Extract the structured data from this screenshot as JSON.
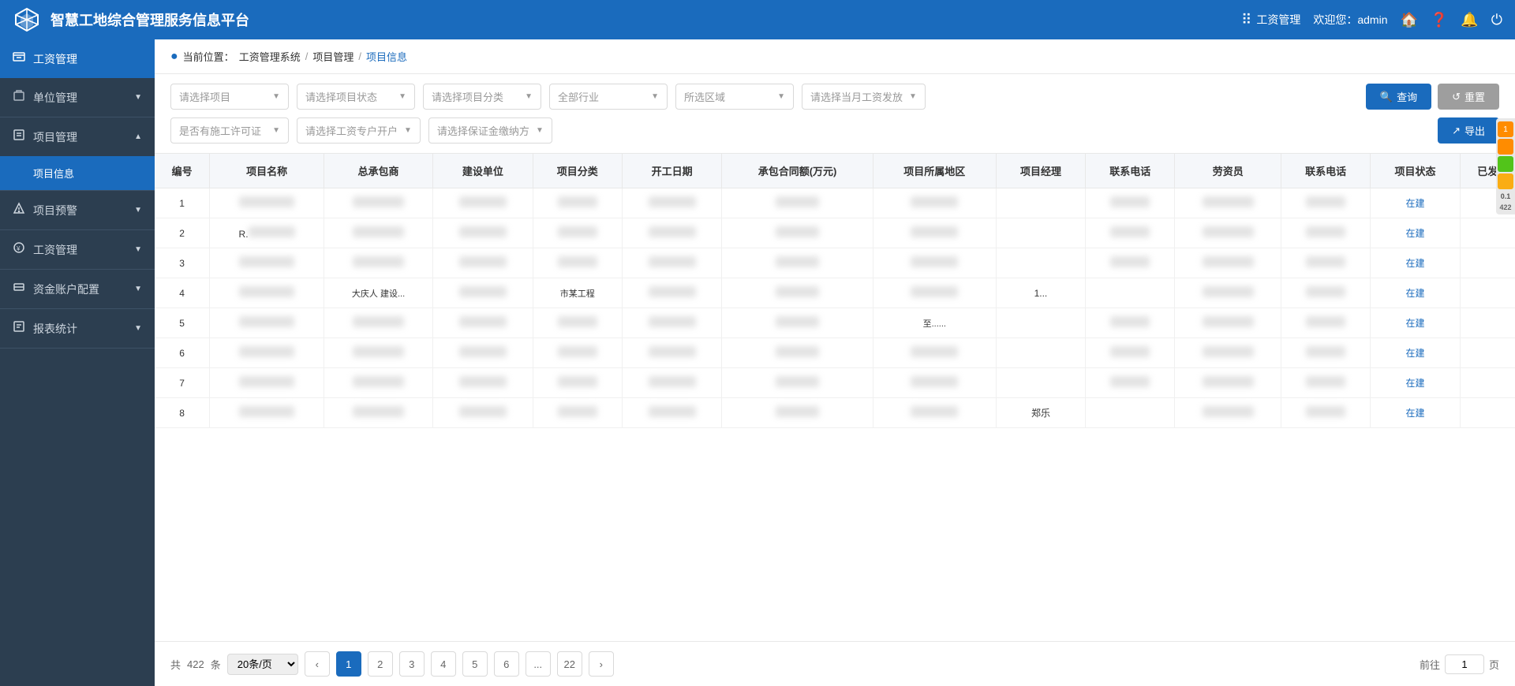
{
  "header": {
    "title": "智慧工地综合管理服务信息平台",
    "module_label": "工资管理",
    "welcome": "欢迎您：admin"
  },
  "breadcrumb": {
    "prefix": "当前位置：",
    "path": [
      "工资管理系统",
      "项目管理",
      "项目信息"
    ]
  },
  "filters": {
    "row1": [
      {
        "id": "select-project",
        "placeholder": "请选择项目"
      },
      {
        "id": "select-status",
        "placeholder": "请选择项目状态"
      },
      {
        "id": "select-category",
        "placeholder": "请选择项目分类"
      },
      {
        "id": "select-industry",
        "placeholder": "全部行业"
      },
      {
        "id": "select-region",
        "placeholder": "所选区域"
      },
      {
        "id": "select-salary",
        "placeholder": "请选择当月工资发放"
      }
    ],
    "row2": [
      {
        "id": "select-permit",
        "placeholder": "是否有施工许可证"
      },
      {
        "id": "select-account",
        "placeholder": "请选择工资专户开户"
      },
      {
        "id": "select-deposit",
        "placeholder": "请选择保证金缴纳方"
      }
    ],
    "buttons": {
      "query": "查询",
      "reset": "重置",
      "export": "导出"
    }
  },
  "table": {
    "columns": [
      "编号",
      "项目名称",
      "总承包商",
      "建设单位",
      "项目分类",
      "开工日期",
      "承包合同额(万元)",
      "项目所属地区",
      "项目经理",
      "联系电话",
      "劳资员",
      "联系电话",
      "项目状态",
      "已发"
    ],
    "rows": [
      {
        "id": 1,
        "status": "在建"
      },
      {
        "id": 2,
        "col2": "R...",
        "status": "在建"
      },
      {
        "id": 3,
        "status": "在建"
      },
      {
        "id": 4,
        "col3_partial": "大庆人  建设...",
        "col5": "市某工程",
        "status": "在建",
        "pm": "1..."
      },
      {
        "id": 5,
        "col8_partial": "至......",
        "status": "在建"
      },
      {
        "id": 6,
        "status": "在建"
      },
      {
        "id": 7,
        "status": "在建"
      },
      {
        "id": 8,
        "pm": "郑乐",
        "status": "在建"
      }
    ]
  },
  "pagination": {
    "total_prefix": "共",
    "total": "422",
    "total_suffix": "条",
    "page_size": "20条/页",
    "pages": [
      "1",
      "2",
      "3",
      "4",
      "5",
      "6",
      "...",
      "22"
    ],
    "jump_prefix": "前往",
    "jump_value": "1",
    "jump_suffix": "页"
  },
  "sidebar": {
    "top_item": {
      "label": "工资管理",
      "icon": "📋"
    },
    "items": [
      {
        "label": "单位管理",
        "icon": "🏢",
        "has_arrow": true,
        "expanded": false
      },
      {
        "label": "项目管理",
        "icon": "📁",
        "has_arrow": true,
        "expanded": true
      },
      {
        "label": "项目信息",
        "sub": true,
        "active": true
      },
      {
        "label": "项目预警",
        "icon": "⚠️",
        "has_arrow": true,
        "expanded": false
      },
      {
        "label": "工资管理",
        "icon": "💰",
        "has_arrow": true,
        "expanded": false
      },
      {
        "label": "资金账户配置",
        "icon": "💳",
        "has_arrow": true,
        "expanded": false
      },
      {
        "label": "报表统计",
        "icon": "📊",
        "has_arrow": true,
        "expanded": false
      }
    ]
  },
  "float_panel": {
    "badge": "1",
    "items": [
      "orange",
      "green",
      "yellow"
    ],
    "count": "422",
    "mini_text": "0.1"
  }
}
